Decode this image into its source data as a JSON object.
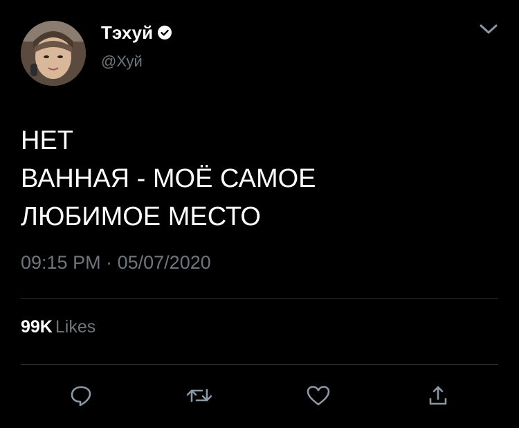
{
  "user": {
    "display_name": "Тэхуй",
    "handle": "@Хуй",
    "verified": true,
    "avatar_icon": "user-avatar-photo"
  },
  "tweet": {
    "lines": [
      "НЕТ",
      "ВАННАЯ - МОЁ САМОЕ",
      "ЛЮБИМОЕ МЕСТО"
    ],
    "time": "09:15 PM",
    "separator": "·",
    "date": "05/07/2020"
  },
  "stats": {
    "likes_count": "99K",
    "likes_label": "Likes"
  },
  "actions": [
    {
      "name": "reply",
      "icon": "speech-bubble-icon"
    },
    {
      "name": "retweet",
      "icon": "retweet-arrows-icon"
    },
    {
      "name": "like",
      "icon": "heart-icon"
    },
    {
      "name": "share",
      "icon": "share-upload-icon"
    }
  ],
  "colors": {
    "background": "#000000",
    "text_primary": "#ffffff",
    "text_secondary": "#6e767d",
    "divider": "#2f3336",
    "icon": "#8b98a5"
  }
}
